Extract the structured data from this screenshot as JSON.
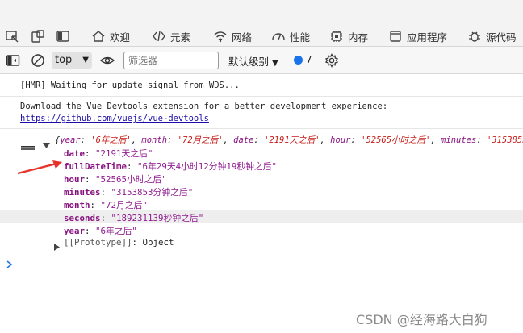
{
  "tabs": [
    {
      "label": "欢迎",
      "icon": "home-icon"
    },
    {
      "label": "元素",
      "icon": "code-icon"
    },
    {
      "label": "网络",
      "icon": "wifi-icon"
    },
    {
      "label": "性能",
      "icon": "gauge-icon"
    },
    {
      "label": "内存",
      "icon": "memory-icon"
    },
    {
      "label": "应用程序",
      "icon": "app-icon"
    },
    {
      "label": "源代码",
      "icon": "bug-icon"
    }
  ],
  "toolbar": {
    "context": "top",
    "filter_placeholder": "筛选器",
    "levels": "默认级别",
    "issues_count": "7"
  },
  "console": {
    "hmr_message": "[HMR] Waiting for update signal from WDS...",
    "devtools_message": "Download the Vue Devtools extension for a better development experience:",
    "devtools_link": "https://github.com/vuejs/vue-devtools",
    "object_summary": {
      "open": "{",
      "p1k": "year",
      "p1v": "'6年之后'",
      "p2k": "month",
      "p2v": "'72月之后'",
      "p3k": "date",
      "p3v": "'2191天之后'",
      "p4k": "hour",
      "p4v": "'52565小时之后'",
      "p5k": "minutes",
      "p5v": "'3153853"
    },
    "properties": [
      {
        "key": "date",
        "value": "\"2191天之后\""
      },
      {
        "key": "fullDateTime",
        "value": "\"6年29天4小时12分钟19秒钟之后\""
      },
      {
        "key": "hour",
        "value": "\"52565小时之后\""
      },
      {
        "key": "minutes",
        "value": "\"3153853分钟之后\""
      },
      {
        "key": "month",
        "value": "\"72月之后\""
      },
      {
        "key": "seconds",
        "value": "\"189231139秒钟之后\""
      },
      {
        "key": "year",
        "value": "\"6年之后\""
      }
    ],
    "prototype": "[[Prototype]]",
    "prototype_value": "Object"
  },
  "watermark": "CSDN @经海路大白狗",
  "colors": {
    "annotation_arrow": "#e8312a",
    "prompt": "#1a73e8"
  }
}
